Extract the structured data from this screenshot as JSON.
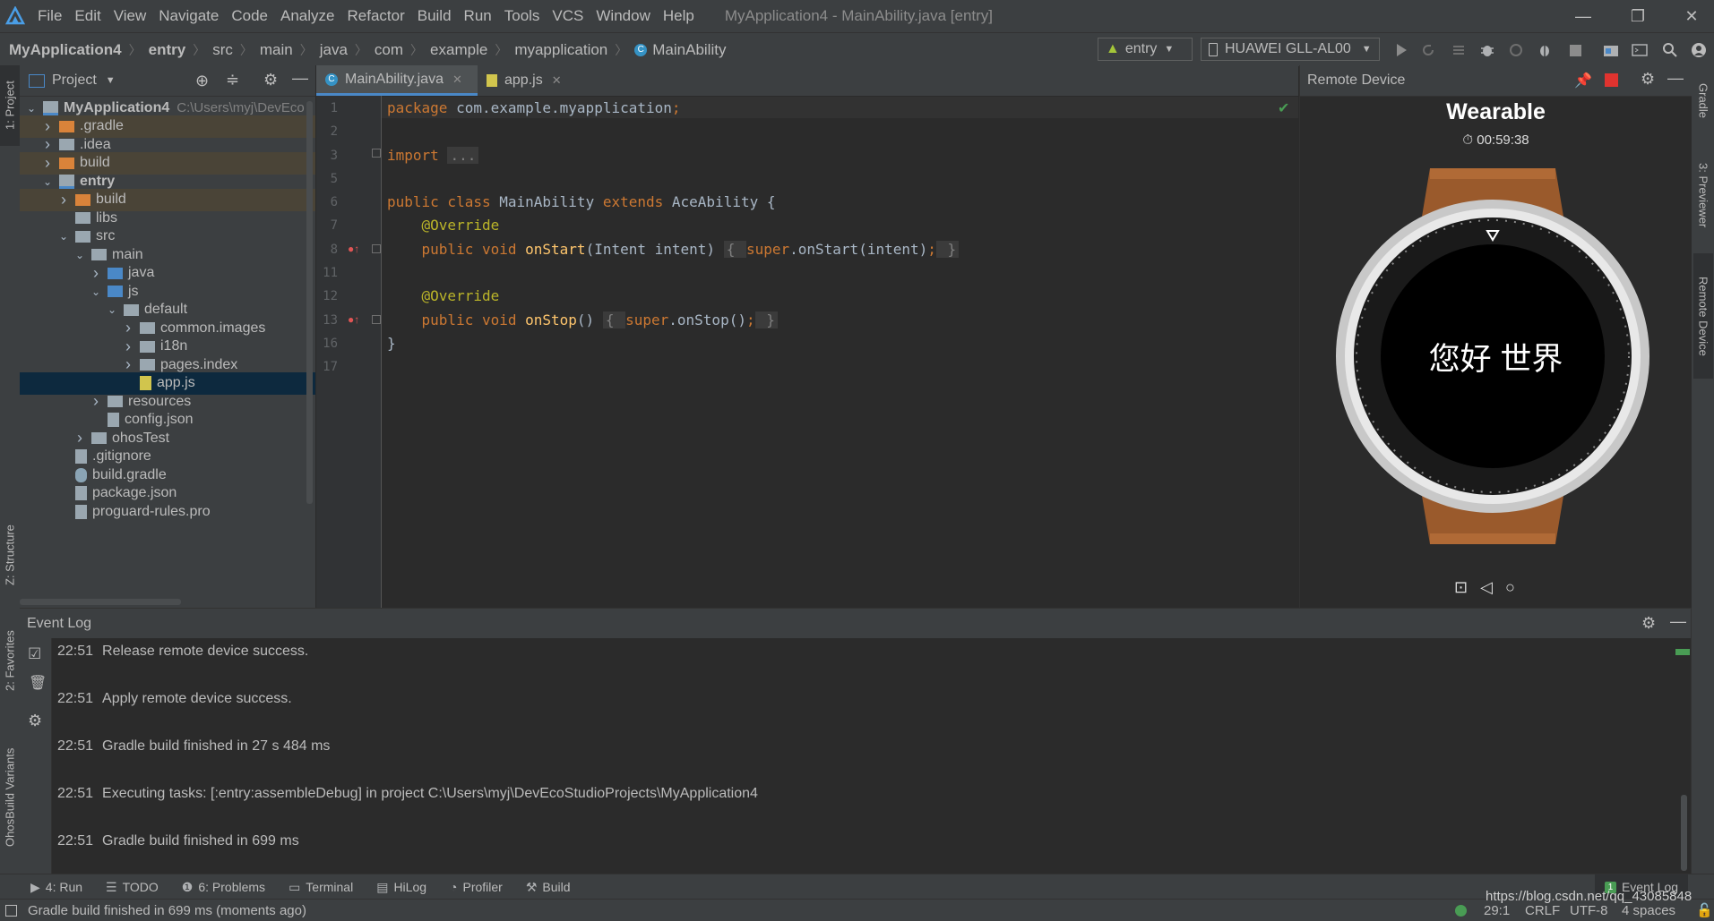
{
  "menubar": {
    "items": [
      "File",
      "Edit",
      "View",
      "Navigate",
      "Code",
      "Analyze",
      "Refactor",
      "Build",
      "Run",
      "Tools",
      "VCS",
      "Window",
      "Help"
    ],
    "title": "MyApplication4 - MainAbility.java [entry]"
  },
  "breadcrumb": [
    "MyApplication4",
    "entry",
    "src",
    "main",
    "java",
    "com",
    "example",
    "myapplication",
    "MainAbility"
  ],
  "toolbar": {
    "run_config": "entry",
    "device": "HUAWEI GLL-AL00"
  },
  "project_panel": {
    "title": "Project",
    "tree": [
      {
        "label": "MyApplication4",
        "extra": "C:\\Users\\myj\\DevEco",
        "depth": 0,
        "arrow": "down",
        "kind": "module",
        "bold": true
      },
      {
        "label": ".gradle",
        "depth": 1,
        "arrow": "right",
        "kind": "folder-orange",
        "hl": true
      },
      {
        "label": ".idea",
        "depth": 1,
        "arrow": "right",
        "kind": "folder"
      },
      {
        "label": "build",
        "depth": 1,
        "arrow": "right",
        "kind": "folder-orange",
        "hl": true
      },
      {
        "label": "entry",
        "depth": 1,
        "arrow": "down",
        "kind": "module",
        "bold": true
      },
      {
        "label": "build",
        "depth": 2,
        "arrow": "right",
        "kind": "folder-orange",
        "hl": true
      },
      {
        "label": "libs",
        "depth": 2,
        "arrow": "",
        "kind": "folder"
      },
      {
        "label": "src",
        "depth": 2,
        "arrow": "down",
        "kind": "folder"
      },
      {
        "label": "main",
        "depth": 3,
        "arrow": "down",
        "kind": "folder"
      },
      {
        "label": "java",
        "depth": 4,
        "arrow": "right",
        "kind": "folder-blue"
      },
      {
        "label": "js",
        "depth": 4,
        "arrow": "down",
        "kind": "folder-blue"
      },
      {
        "label": "default",
        "depth": 5,
        "arrow": "down",
        "kind": "folder"
      },
      {
        "label": "common.images",
        "depth": 6,
        "arrow": "right",
        "kind": "folder"
      },
      {
        "label": "i18n",
        "depth": 6,
        "arrow": "right",
        "kind": "folder"
      },
      {
        "label": "pages.index",
        "depth": 6,
        "arrow": "right",
        "kind": "folder"
      },
      {
        "label": "app.js",
        "depth": 6,
        "arrow": "",
        "kind": "js",
        "sel": true
      },
      {
        "label": "resources",
        "depth": 4,
        "arrow": "right",
        "kind": "folder-res"
      },
      {
        "label": "config.json",
        "depth": 4,
        "arrow": "",
        "kind": "file"
      },
      {
        "label": "ohosTest",
        "depth": 3,
        "arrow": "right",
        "kind": "folder"
      },
      {
        "label": ".gitignore",
        "depth": 2,
        "arrow": "",
        "kind": "file"
      },
      {
        "label": "build.gradle",
        "depth": 2,
        "arrow": "",
        "kind": "gradle"
      },
      {
        "label": "package.json",
        "depth": 2,
        "arrow": "",
        "kind": "file"
      },
      {
        "label": "proguard-rules.pro",
        "depth": 2,
        "arrow": "",
        "kind": "file"
      }
    ]
  },
  "editor": {
    "tabs": [
      {
        "label": "MainAbility.java",
        "active": true
      },
      {
        "label": "app.js",
        "active": false
      }
    ],
    "line_numbers": [
      "1",
      "2",
      "3",
      "5",
      "6",
      "7",
      "8",
      "11",
      "12",
      "13",
      "16",
      "17"
    ],
    "code": [
      [
        [
          "kw",
          "package "
        ],
        [
          "",
          "com.example.myapplication"
        ],
        [
          "kw",
          ";"
        ]
      ],
      [],
      [
        [
          "kw",
          "import "
        ],
        [
          "fold",
          "..."
        ]
      ],
      [],
      [
        [
          "kw",
          "public class "
        ],
        [
          "",
          "MainAbility "
        ],
        [
          "kw",
          "extends "
        ],
        [
          "",
          "AceAbility {"
        ]
      ],
      [
        [
          "",
          "    "
        ],
        [
          "an",
          "@Override"
        ]
      ],
      [
        [
          "",
          "    "
        ],
        [
          "kw",
          "public void "
        ],
        [
          "fn",
          "onStart"
        ],
        [
          "",
          "(Intent intent) "
        ],
        [
          "fold",
          "{ "
        ],
        [
          "kw",
          "super"
        ],
        [
          "",
          ".onStart(intent)"
        ],
        [
          "kw",
          ";"
        ],
        [
          "fold",
          " }"
        ]
      ],
      [],
      [
        [
          "",
          "    "
        ],
        [
          "an",
          "@Override"
        ]
      ],
      [
        [
          "",
          "    "
        ],
        [
          "kw",
          "public void "
        ],
        [
          "fn",
          "onStop"
        ],
        [
          "",
          "() "
        ],
        [
          "fold",
          "{ "
        ],
        [
          "kw",
          "super"
        ],
        [
          "",
          ".onStop()"
        ],
        [
          "kw",
          ";"
        ],
        [
          "fold",
          " }"
        ]
      ],
      [
        [
          "",
          "}"
        ]
      ],
      []
    ]
  },
  "remote_device": {
    "title": "Remote Device",
    "device_name": "Wearable",
    "timer": "00:59:38",
    "screen_text": "您好 世界"
  },
  "event_log": {
    "title": "Event Log",
    "entries": [
      {
        "time": "22:51",
        "text": "Release remote device success."
      },
      {
        "time": "22:51",
        "text": "Apply remote device success."
      },
      {
        "time": "22:51",
        "text": "Gradle build finished in 27 s 484 ms"
      },
      {
        "time": "22:51",
        "text": "Executing tasks: [:entry:assembleDebug] in project C:\\Users\\myj\\DevEcoStudioProjects\\MyApplication4"
      },
      {
        "time": "22:51",
        "text": "Gradle build finished in 699 ms"
      }
    ]
  },
  "bottom_tabs": [
    "4: Run",
    "TODO",
    "6: Problems",
    "Terminal",
    "HiLog",
    "Profiler",
    "Build"
  ],
  "bottom_right_tab": "Event Log",
  "left_stripe": [
    "1: Project",
    "Z: Structure",
    "2: Favorites",
    "OhosBuild Variants"
  ],
  "right_stripe": [
    "Gradle",
    "3: Previewer",
    "Remote Device"
  ],
  "status": {
    "message": "Gradle build finished in 699 ms (moments ago)",
    "position": "29:1",
    "line_sep": "CRLF",
    "encoding": "UTF-8",
    "indent": "4 spaces",
    "watermark": "https://blog.csdn.net/qq_43085848"
  }
}
